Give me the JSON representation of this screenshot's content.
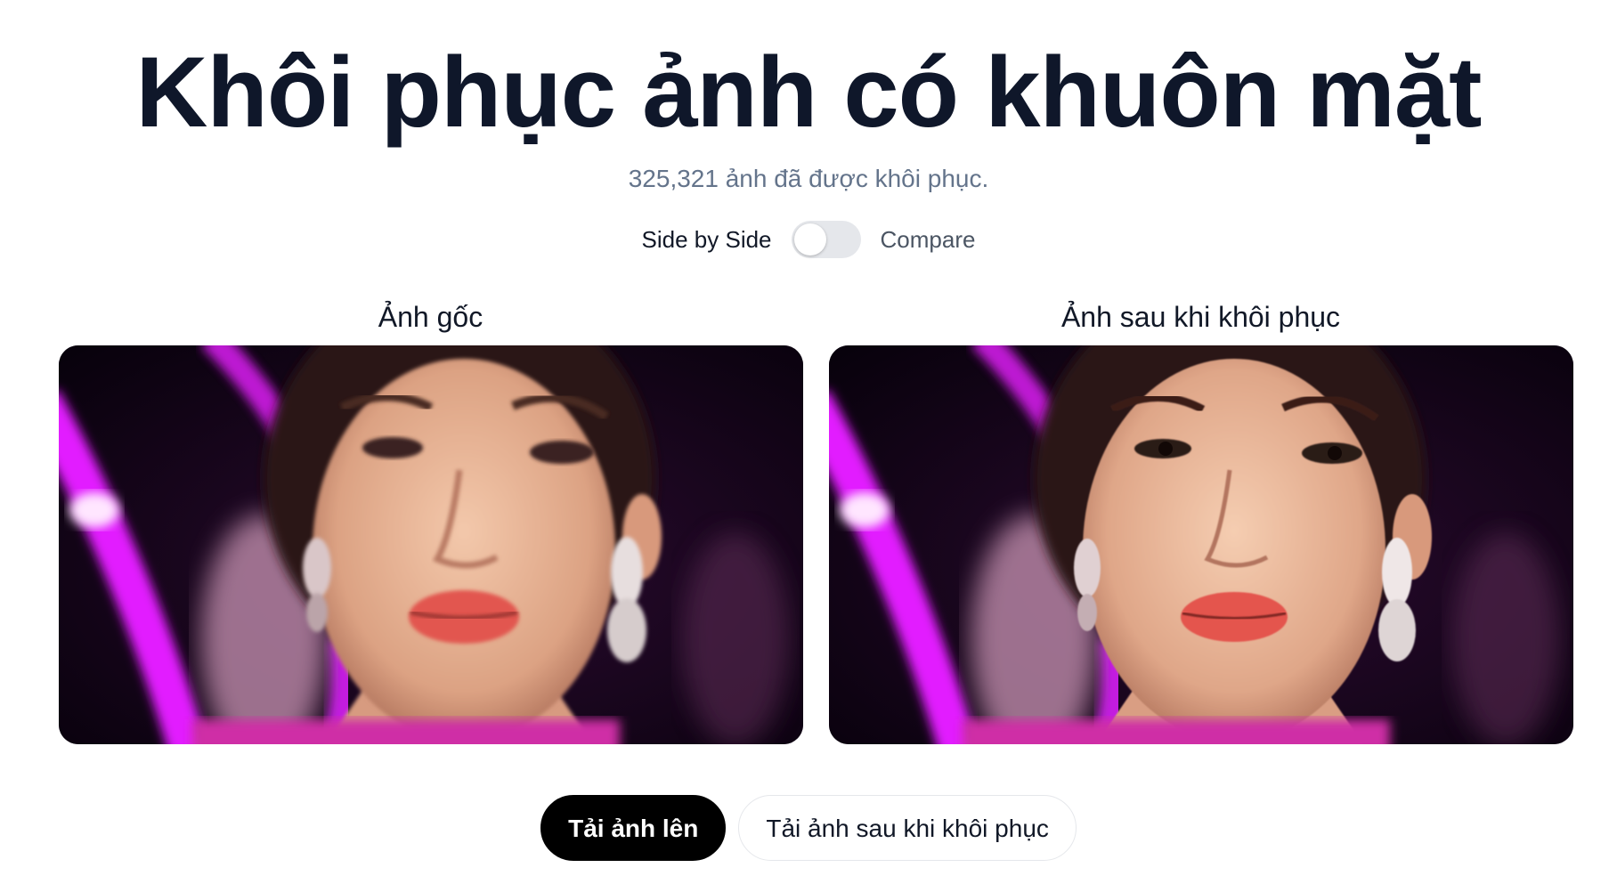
{
  "header": {
    "title": "Khôi phục ảnh có khuôn mặt",
    "subtitle": "325,321 ảnh đã được khôi phục."
  },
  "view_toggle": {
    "left_label": "Side by Side",
    "right_label": "Compare",
    "is_compare": false
  },
  "panels": {
    "original_title": "Ảnh gốc",
    "restored_title": "Ảnh sau khi khôi phục"
  },
  "actions": {
    "upload_label": "Tải ảnh lên",
    "download_label": "Tải ảnh sau khi khôi phục"
  },
  "colors": {
    "title": "#0f172a",
    "subtitle": "#64748b",
    "primary_button": "#000000",
    "toggle_track": "#e5e7eb",
    "photo_background": "#0b0310",
    "neon_accent": "#e21aff"
  }
}
